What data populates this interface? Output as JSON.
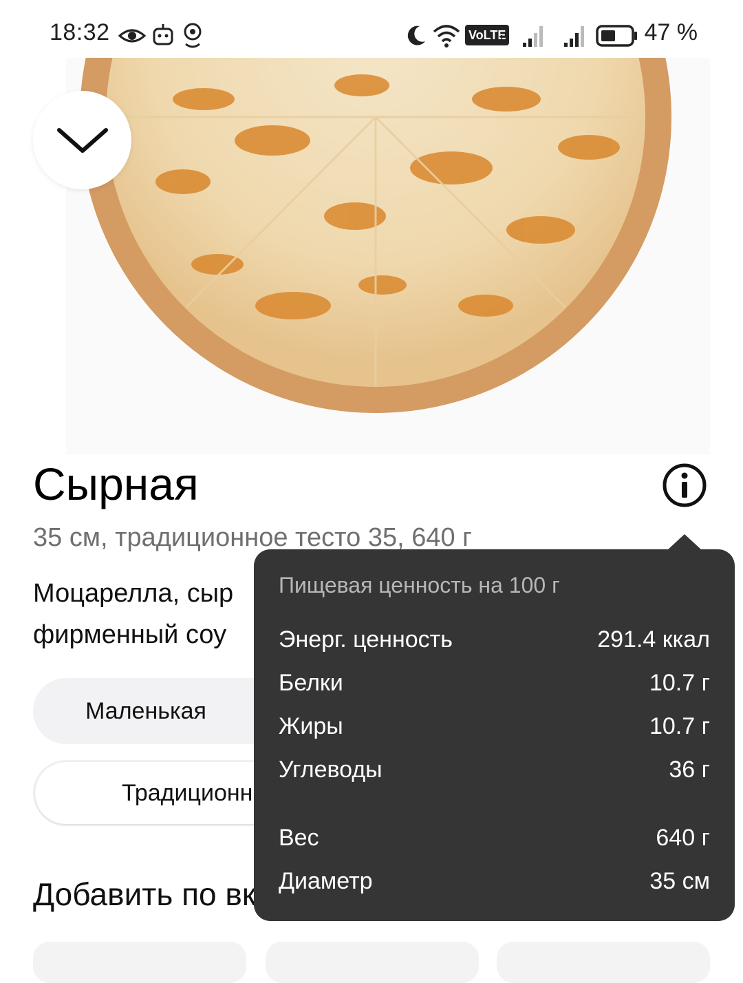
{
  "status_bar": {
    "time": "18:32",
    "battery": "47 %",
    "icons": [
      "eye-icon",
      "robot-icon",
      "location-icon",
      "moon-icon",
      "wifi-icon",
      "volte-icon",
      "signal-icon",
      "signal-icon",
      "battery-icon"
    ],
    "volte_label": "VoLTE",
    "sim_index": "1"
  },
  "product": {
    "title": "Сырная",
    "subtitle": "35 см, традиционное тесто 35, 640 г",
    "description_line1": "Моцарелла, сыр",
    "description_line2": "фирменный соу",
    "size_option": "Маленькая",
    "dough_option": "Традиционн",
    "add_section_title": "Добавить по вк"
  },
  "nutrition": {
    "header": "Пищевая ценность на 100 г",
    "rows": [
      {
        "label": "Энерг. ценность",
        "value": "291.4 ккал"
      },
      {
        "label": "Белки",
        "value": "10.7 г"
      },
      {
        "label": "Жиры",
        "value": "10.7 г"
      },
      {
        "label": "Углеводы",
        "value": "36 г"
      },
      {
        "label": "Вес",
        "value": "640 г"
      },
      {
        "label": "Диаметр",
        "value": "35 см"
      }
    ]
  },
  "colors": {
    "tooltip_bg": "#353535",
    "segment_bg": "#f2f2f4",
    "subtitle_text": "#6f6f6f",
    "pizza_crust": "#d59a62",
    "pizza_cheese": "#f3e3c4"
  }
}
